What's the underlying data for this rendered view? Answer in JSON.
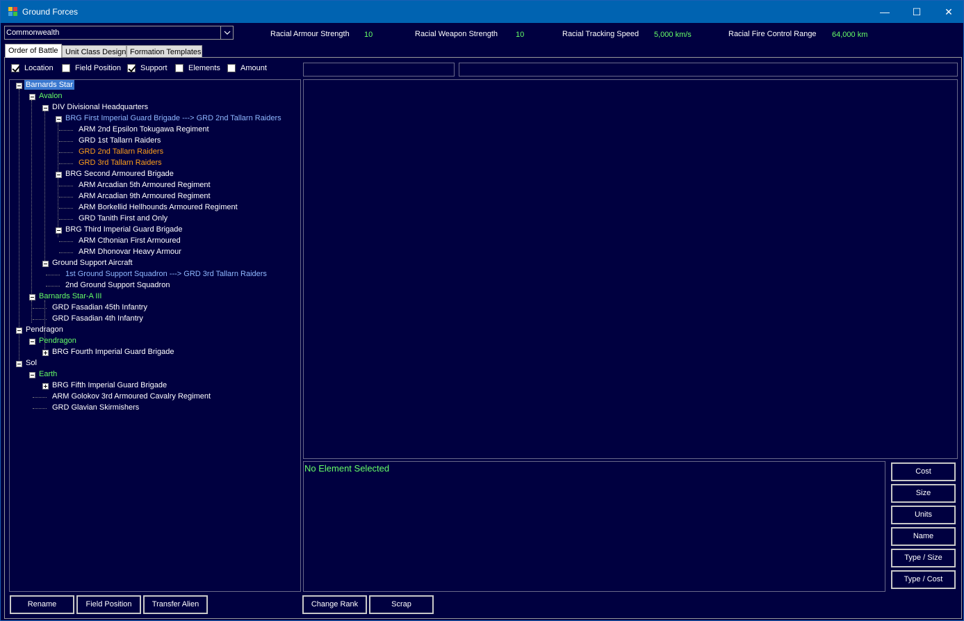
{
  "window": {
    "title": "Ground Forces",
    "minimize": "—",
    "maximize": "☐",
    "close": "✕"
  },
  "race_select": {
    "value": "Commonwealth"
  },
  "stats": [
    {
      "label": "Racial Armour Strength",
      "value": "10"
    },
    {
      "label": "Racial  Weapon Strength",
      "value": "10"
    },
    {
      "label": "Racial  Tracking Speed",
      "value": "5,000 km/s"
    },
    {
      "label": "Racial Fire Control Range",
      "value": "64,000 km"
    }
  ],
  "tabs": [
    {
      "label": "Order of Battle",
      "active": true
    },
    {
      "label": "Unit Class Design",
      "active": false
    },
    {
      "label": "Formation Templates",
      "active": false
    }
  ],
  "filters": [
    {
      "label": "Location",
      "checked": true
    },
    {
      "label": "Field Position",
      "checked": false
    },
    {
      "label": "Support",
      "checked": true
    },
    {
      "label": "Elements",
      "checked": false
    },
    {
      "label": "Amount",
      "checked": false
    }
  ],
  "tree": [
    {
      "text": "Barnards Star",
      "level": 0,
      "toggle": "minus",
      "color": "sel"
    },
    {
      "text": "Avalon",
      "level": 1,
      "toggle": "minus",
      "color": "green"
    },
    {
      "text": "DIV Divisional Headquarters",
      "level": 2,
      "toggle": "minus",
      "color": "white"
    },
    {
      "text": "BRG First Imperial Guard Brigade ---> GRD 2nd Tallarn Raiders",
      "level": 3,
      "toggle": "minus",
      "color": "blue"
    },
    {
      "text": "ARM 2nd Epsilon Tokugawa Regiment",
      "level": 4,
      "toggle": "",
      "color": "white"
    },
    {
      "text": "GRD 1st Tallarn Raiders",
      "level": 4,
      "toggle": "",
      "color": "white"
    },
    {
      "text": "GRD 2nd Tallarn Raiders",
      "level": 4,
      "toggle": "",
      "color": "orange"
    },
    {
      "text": "GRD 3rd Tallarn Raiders",
      "level": 4,
      "toggle": "",
      "color": "orange"
    },
    {
      "text": "BRG Second Armoured Brigade",
      "level": 3,
      "toggle": "minus",
      "color": "white"
    },
    {
      "text": "ARM Arcadian 5th Armoured Regiment",
      "level": 4,
      "toggle": "",
      "color": "white"
    },
    {
      "text": "ARM Arcadian 9th Armoured Regiment",
      "level": 4,
      "toggle": "",
      "color": "white"
    },
    {
      "text": "ARM Borkellid Hellhounds Armoured Regiment",
      "level": 4,
      "toggle": "",
      "color": "white"
    },
    {
      "text": "GRD Tanith First and Only",
      "level": 4,
      "toggle": "",
      "color": "white"
    },
    {
      "text": "BRG Third Imperial Guard Brigade",
      "level": 3,
      "toggle": "minus",
      "color": "white"
    },
    {
      "text": "ARM Cthonian First Armoured",
      "level": 4,
      "toggle": "",
      "color": "white"
    },
    {
      "text": "ARM Dhonovar Heavy Armour",
      "level": 4,
      "toggle": "",
      "color": "white"
    },
    {
      "text": "Ground Support Aircraft",
      "level": 2,
      "toggle": "minus",
      "color": "white"
    },
    {
      "text": "1st Ground Support Squadron ---> GRD 3rd Tallarn Raiders",
      "level": 3,
      "toggle": "",
      "color": "blue"
    },
    {
      "text": "2nd Ground Support Squadron",
      "level": 3,
      "toggle": "",
      "color": "white"
    },
    {
      "text": "Barnards Star-A III",
      "level": 1,
      "toggle": "minus",
      "color": "green"
    },
    {
      "text": "GRD Fasadian 45th Infantry",
      "level": 2,
      "toggle": "",
      "color": "white"
    },
    {
      "text": "GRD Fasadian 4th Infantry",
      "level": 2,
      "toggle": "",
      "color": "white"
    },
    {
      "text": "Pendragon",
      "level": 0,
      "toggle": "minus",
      "color": "white"
    },
    {
      "text": "Pendragon",
      "level": 1,
      "toggle": "minus",
      "color": "green"
    },
    {
      "text": "BRG Fourth Imperial Guard Brigade",
      "level": 2,
      "toggle": "plus",
      "color": "white"
    },
    {
      "text": "Sol",
      "level": 0,
      "toggle": "minus",
      "color": "white"
    },
    {
      "text": "Earth",
      "level": 1,
      "toggle": "minus",
      "color": "green"
    },
    {
      "text": "BRG Fifth Imperial Guard Brigade",
      "level": 2,
      "toggle": "plus",
      "color": "white"
    },
    {
      "text": "ARM Golokov 3rd Armoured Cavalry Regiment",
      "level": 2,
      "toggle": "",
      "color": "white"
    },
    {
      "text": "GRD Glavian Skirmishers",
      "level": 2,
      "toggle": "",
      "color": "white"
    }
  ],
  "detail": {
    "no_selection": "No Element Selected"
  },
  "sort_buttons": [
    "Cost",
    "Size",
    "Units",
    "Name",
    "Type / Size",
    "Type / Cost"
  ],
  "bottom_buttons": {
    "rename": "Rename",
    "field_position": "Field Position",
    "transfer_alien": "Transfer Alien",
    "change_rank": "Change Rank",
    "scrap": "Scrap"
  },
  "colors": {
    "background": "#000040",
    "titlebar": "#0063b1",
    "green_text": "#66ff66",
    "blue_text": "#8fb8ff",
    "orange_text": "#ff9f1a",
    "selection": "#3a78d0"
  }
}
